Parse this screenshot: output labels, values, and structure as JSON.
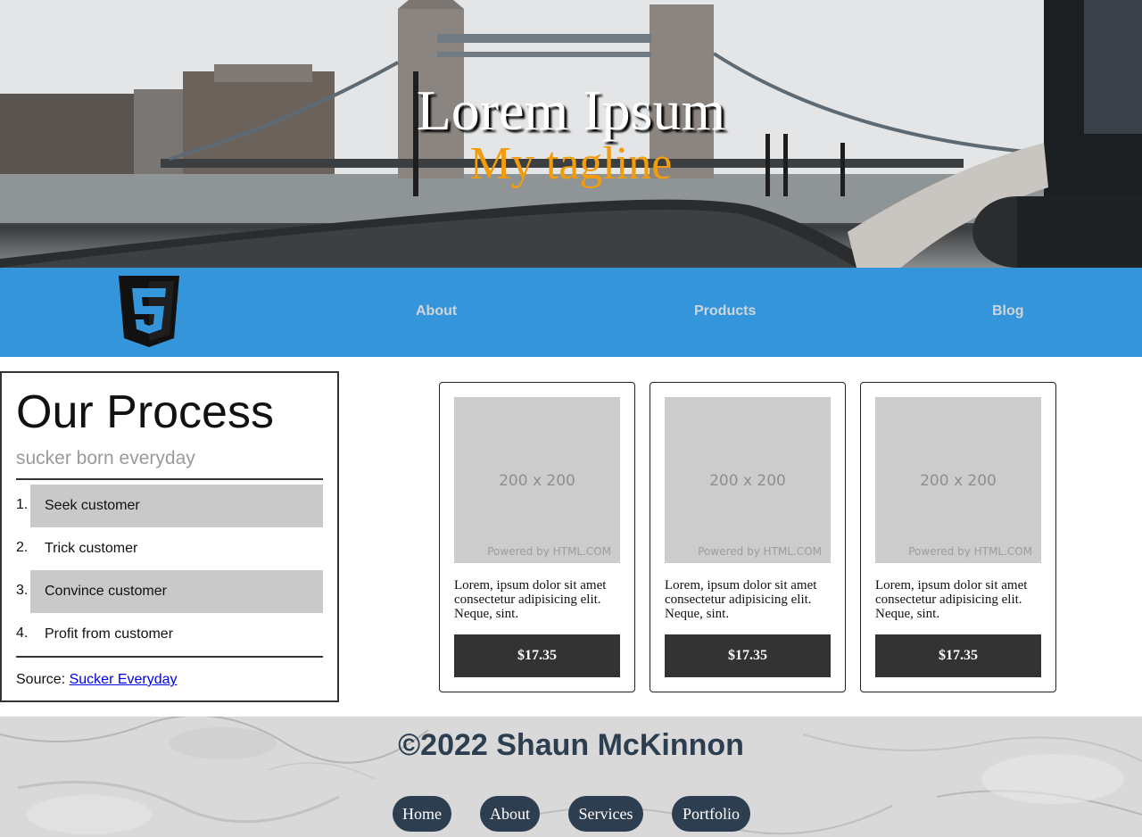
{
  "hero": {
    "title": "Lorem Ipsum",
    "tagline": "My tagline"
  },
  "nav": {
    "logo_icon": "html5-shield-icon",
    "links": [
      {
        "label": "About"
      },
      {
        "label": "Products"
      },
      {
        "label": "Blog"
      }
    ]
  },
  "process": {
    "title": "Our Process",
    "subtitle": "sucker born everyday",
    "steps": [
      {
        "num": "1.",
        "label": "Seek customer"
      },
      {
        "num": "2.",
        "label": "Trick customer"
      },
      {
        "num": "3.",
        "label": "Convince customer"
      },
      {
        "num": "4.",
        "label": "Profit from customer"
      }
    ],
    "source_label": "Source:",
    "source_link": "Sucker Everyday"
  },
  "products": [
    {
      "image_dim": "200 x 200",
      "image_powered": "Powered by HTML.COM",
      "description": "Lorem, ipsum dolor sit amet consectetur adipisicing elit. Neque, sint.",
      "price": "$17.35"
    },
    {
      "image_dim": "200 x 200",
      "image_powered": "Powered by HTML.COM",
      "description": "Lorem, ipsum dolor sit amet consectetur adipisicing elit. Neque, sint.",
      "price": "$17.35"
    },
    {
      "image_dim": "200 x 200",
      "image_powered": "Powered by HTML.COM",
      "description": "Lorem, ipsum dolor sit amet consectetur adipisicing elit. Neque, sint.",
      "price": "$17.35"
    }
  ],
  "footer": {
    "copyright": "©2022 Shaun McKinnon",
    "links": [
      {
        "label": "Home"
      },
      {
        "label": "About"
      },
      {
        "label": "Services"
      },
      {
        "label": "Portfolio"
      }
    ]
  },
  "colors": {
    "nav_bg": "#3495db",
    "nav_link": "#cfd5da",
    "tagline": "#f29b0b",
    "price_bg": "#333333",
    "footer_text": "#2c3e50"
  }
}
